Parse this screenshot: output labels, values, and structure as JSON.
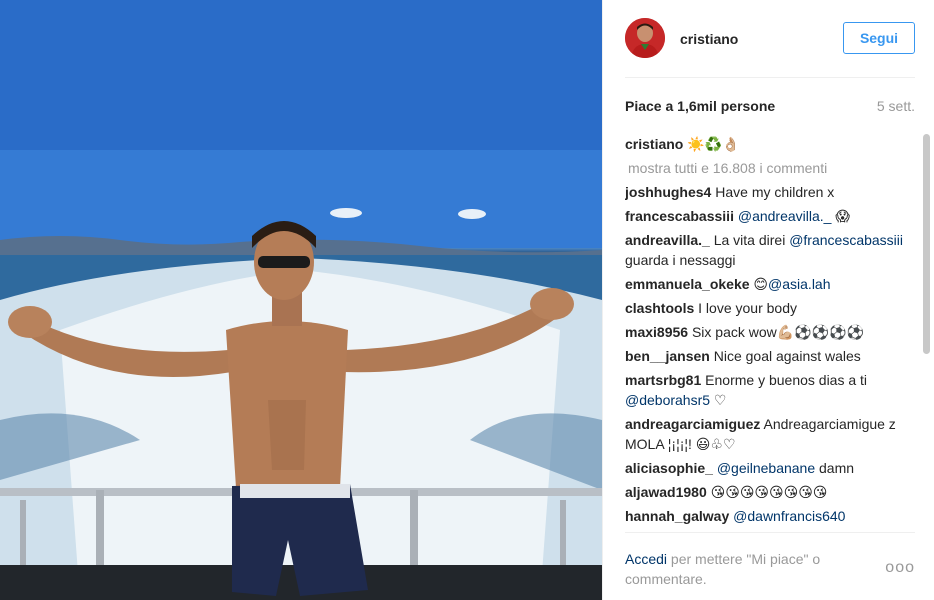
{
  "post": {
    "username": "cristiano",
    "follow_label": "Segui",
    "likes": "Piace a 1,6mil persone",
    "time_ago": "5 sett.",
    "caption": {
      "user": "cristiano",
      "text": "☀️♻️👌🏼"
    },
    "view_all": "mostra tutti e 16.808 i commenti",
    "comments": [
      {
        "user": "joshhughes4",
        "parts": [
          {
            "t": "Have my children x",
            "m": false
          }
        ]
      },
      {
        "user": "francescabassiii",
        "parts": [
          {
            "t": "@andreavilla._",
            "m": true
          },
          {
            "t": " 😱",
            "m": false
          }
        ]
      },
      {
        "user": "andreavilla._",
        "parts": [
          {
            "t": "La vita direi ",
            "m": false
          },
          {
            "t": "@francescabassiii",
            "m": true
          },
          {
            "t": " guarda i nessaggi",
            "m": false
          }
        ]
      },
      {
        "user": "emmanuela_okeke",
        "parts": [
          {
            "t": "😊",
            "m": false
          },
          {
            "t": "@asia.lah",
            "m": true
          }
        ]
      },
      {
        "user": "clashtools",
        "parts": [
          {
            "t": "I love your body",
            "m": false
          }
        ]
      },
      {
        "user": "maxi8956",
        "parts": [
          {
            "t": "Six pack wow💪🏼⚽⚽⚽⚽",
            "m": false
          }
        ]
      },
      {
        "user": "ben__jansen",
        "parts": [
          {
            "t": "Nice goal against wales",
            "m": false
          }
        ]
      },
      {
        "user": "martsrbg81",
        "parts": [
          {
            "t": "Enorme y buenos dias a ti ",
            "m": false
          },
          {
            "t": "@deborahsr5",
            "m": true
          },
          {
            "t": " ♡",
            "m": false
          }
        ]
      },
      {
        "user": "andreagarciamiguez",
        "parts": [
          {
            "t": "Andreagarciamigue z MOLA ¦¡¦¡¦! 😃♧♡",
            "m": false
          }
        ]
      },
      {
        "user": "aliciasophie_",
        "parts": [
          {
            "t": "@geilnebanane",
            "m": true
          },
          {
            "t": " damn",
            "m": false
          }
        ]
      },
      {
        "user": "aljawad1980",
        "parts": [
          {
            "t": "😘😘😘😘😘😘😘😘",
            "m": false
          }
        ]
      },
      {
        "user": "hannah_galway",
        "parts": [
          {
            "t": "@dawnfrancis640",
            "m": true
          }
        ]
      }
    ],
    "login_link": "Accedi",
    "login_rest": " per mettere \"Mi piace\" o commentare.",
    "more_label": "ooo"
  }
}
